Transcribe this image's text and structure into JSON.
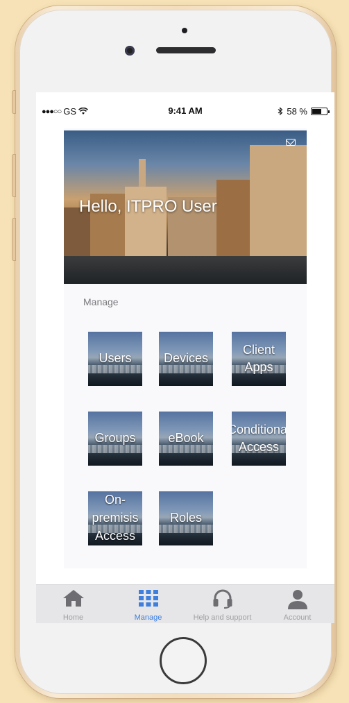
{
  "status_bar": {
    "carrier": "GS",
    "time": "9:41 AM",
    "battery": "58 %"
  },
  "hero": {
    "greeting": "Hello, ITPRO User"
  },
  "manage": {
    "section_label": "Manage",
    "tiles": [
      {
        "label_line1": "Users",
        "label_line2": ""
      },
      {
        "label_line1": "Devices",
        "label_line2": ""
      },
      {
        "label_line1": "Client",
        "label_line2": "Apps"
      },
      {
        "label_line1": "Groups",
        "label_line2": ""
      },
      {
        "label_line1": "eBook",
        "label_line2": ""
      },
      {
        "label_line1": "Conditional",
        "label_line2": "Access"
      },
      {
        "label_line1": "On-premisis",
        "label_line2": "Access"
      },
      {
        "label_line1": "Roles",
        "label_line2": ""
      }
    ]
  },
  "tabbar": {
    "items": [
      {
        "label": "Home",
        "icon": "home-icon"
      },
      {
        "label": "Manage",
        "icon": "grid-icon"
      },
      {
        "label": "Help and support",
        "icon": "headset-icon"
      },
      {
        "label": "Account",
        "icon": "user-icon"
      }
    ],
    "active_color": "#3d7ede",
    "inactive_color": "#a0a0a4"
  }
}
